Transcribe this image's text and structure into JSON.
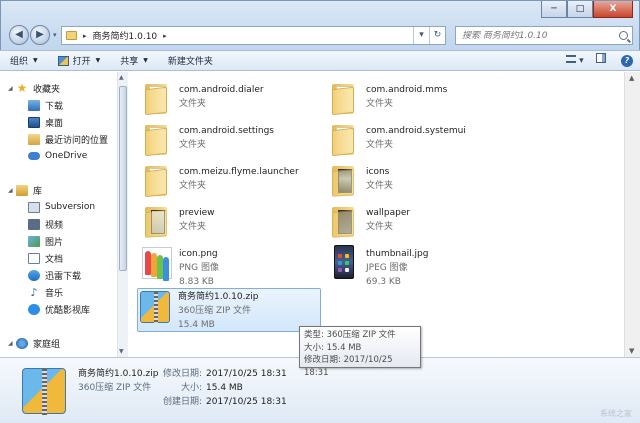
{
  "window": {
    "minimize": "─",
    "maximize": "□",
    "close": "X"
  },
  "address": {
    "crumb_sep": "▸",
    "crumb": "商务简约1.0.10",
    "crumb_arrow": "▸",
    "dropdown": "▾",
    "refresh": "↻"
  },
  "search": {
    "placeholder": "搜索 商务简约1.0.10"
  },
  "toolbar": {
    "organize": "组织",
    "open": "打开",
    "share": "共享",
    "new_folder": "新建文件夹"
  },
  "nav": {
    "favorites": "收藏夹",
    "downloads": "下载",
    "desktop": "桌面",
    "recent": "最近访问的位置",
    "onedrive": "OneDrive",
    "libraries": "库",
    "subversion": "Subversion",
    "videos": "视频",
    "pictures": "图片",
    "documents": "文档",
    "xunlei": "迅雷下载",
    "music": "音乐",
    "youku": "优酷影视库",
    "homegroup": "家庭组"
  },
  "files": [
    {
      "name": "com.android.dialer",
      "type": "文件夹"
    },
    {
      "name": "com.android.mms",
      "type": "文件夹"
    },
    {
      "name": "com.android.settings",
      "type": "文件夹"
    },
    {
      "name": "com.android.systemui",
      "type": "文件夹"
    },
    {
      "name": "com.meizu.flyme.launcher",
      "type": "文件夹"
    },
    {
      "name": "icons",
      "type": "文件夹"
    },
    {
      "name": "preview",
      "type": "文件夹"
    },
    {
      "name": "wallpaper",
      "type": "文件夹"
    },
    {
      "name": "icon.png",
      "type": "PNG 图像",
      "size": "8.83 KB"
    },
    {
      "name": "thumbnail.jpg",
      "type": "JPEG 图像",
      "size": "69.3 KB"
    },
    {
      "name": "商务简约1.0.10.zip",
      "type": "360压缩 ZIP 文件",
      "size": "15.4 MB"
    }
  ],
  "tooltip": {
    "type": "类型: 360压缩 ZIP 文件",
    "size": "大小: 15.4 MB",
    "modified": "修改日期: 2017/10/25 18:31"
  },
  "details": {
    "name": "商务简约1.0.10.zip",
    "type": "360压缩 ZIP 文件",
    "modified_label": "修改日期:",
    "modified": "2017/10/25 18:31",
    "size_label": "大小:",
    "size": "15.4 MB",
    "created_label": "创建日期:",
    "created": "2017/10/25 18:31"
  },
  "watermark": "系统之家",
  "colors": {
    "selection": "#d2e7fb",
    "chrome": "#c4d8ee",
    "accent": "#2d66b5"
  }
}
